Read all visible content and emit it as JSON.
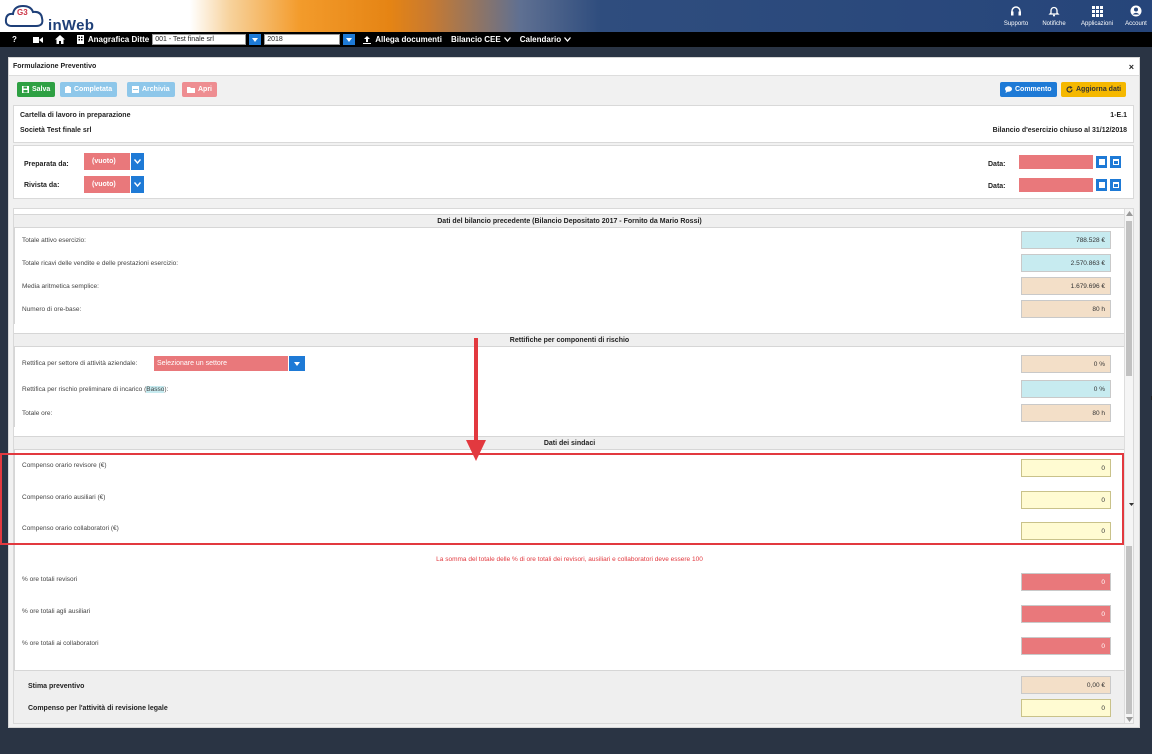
{
  "brand": {
    "name": "inWeb",
    "logo_letters": "G3"
  },
  "topbar": {
    "items": [
      {
        "label": "Supporto",
        "icon": "headset-icon"
      },
      {
        "label": "Notifiche",
        "icon": "bell-icon"
      },
      {
        "label": "Applicazioni",
        "icon": "grid-icon"
      },
      {
        "label": "Account",
        "icon": "user-icon"
      }
    ]
  },
  "navbar": {
    "help": "?",
    "company_label": "Anagrafica Ditte",
    "company_value": "001 - Test finale srl",
    "year_value": "2018",
    "attach_label": "Allega documenti",
    "bilancio_label": "Bilancio CEE",
    "calendar_label": "Calendario"
  },
  "panel": {
    "title": "Formulazione Preventivo",
    "close": "×",
    "toolbar": {
      "save": "Salva",
      "complete": "Completata",
      "archive": "Archivia",
      "open": "Apri",
      "comment": "Commento",
      "refresh": "Aggiorna dati"
    },
    "info": {
      "status": "Cartella di lavoro in preparazione",
      "company": "Società Test finale srl",
      "code": "1-E.1",
      "period": "Bilancio d'esercizio chiuso al 31/12/2018"
    },
    "signers": {
      "prepared_label": "Preparata da:",
      "prepared_value": "(vuoto)",
      "reviewed_label": "Rivista da:",
      "reviewed_value": "(vuoto)",
      "date_label": "Data:"
    }
  },
  "prev_balance": {
    "title": "Dati del bilancio precedente (Bilancio Depositato 2017 - Fornito da Mario Rossi)",
    "rows": [
      {
        "label": "Totale attivo esercizio:",
        "value": "788.528 €"
      },
      {
        "label": "Totale ricavi delle vendite e delle prestazioni esercizio:",
        "value": "2.570.863 €"
      },
      {
        "label": "Media aritmetica semplice:",
        "value": "1.679.696 €"
      },
      {
        "label": "Numero di ore-base:",
        "value": "80 h"
      }
    ]
  },
  "risk": {
    "title": "Rettifiche per componenti di rischio",
    "sector_label": "Rettifica per settore di attività aziendale:",
    "sector_placeholder": "Selezionare un settore",
    "sector_value": "0 %",
    "preliminary_label_a": "Rettifica per rischio preliminare di incarico (",
    "preliminary_level": "Basso",
    "preliminary_label_b": "):",
    "preliminary_value": "0 %",
    "total_label": "Totale ore:",
    "total_value": "80 h"
  },
  "auditors": {
    "title": "Dati dei sindaci",
    "rows": [
      {
        "label": "Compenso orario revisore (€)",
        "value": "0"
      },
      {
        "label": "Compenso orario ausiliari (€)",
        "value": "0"
      },
      {
        "label": "Compenso orario collaboratori (€)",
        "value": "0"
      }
    ],
    "warning": "La somma del totale delle % di ore totali dei revisori, ausiliari e collaboratori deve essere 100",
    "pct_rows": [
      {
        "label": "% ore totali revisori",
        "value": "0"
      },
      {
        "label": "% ore totali agli ausiliari",
        "value": "0"
      },
      {
        "label": "% ore totali ai collaboratori",
        "value": "0"
      }
    ]
  },
  "estimate": {
    "label": "Stima preventivo",
    "value": "0,00 €",
    "fee_label": "Compenso per l'attività di revisione legale",
    "fee_value": "0"
  },
  "colors": {
    "accent_blue": "#1e7ad6",
    "save_green": "#2ea043",
    "refresh_yellow": "#f5b800",
    "error_red": "#e9787b",
    "annotation_red": "#e2393f"
  }
}
